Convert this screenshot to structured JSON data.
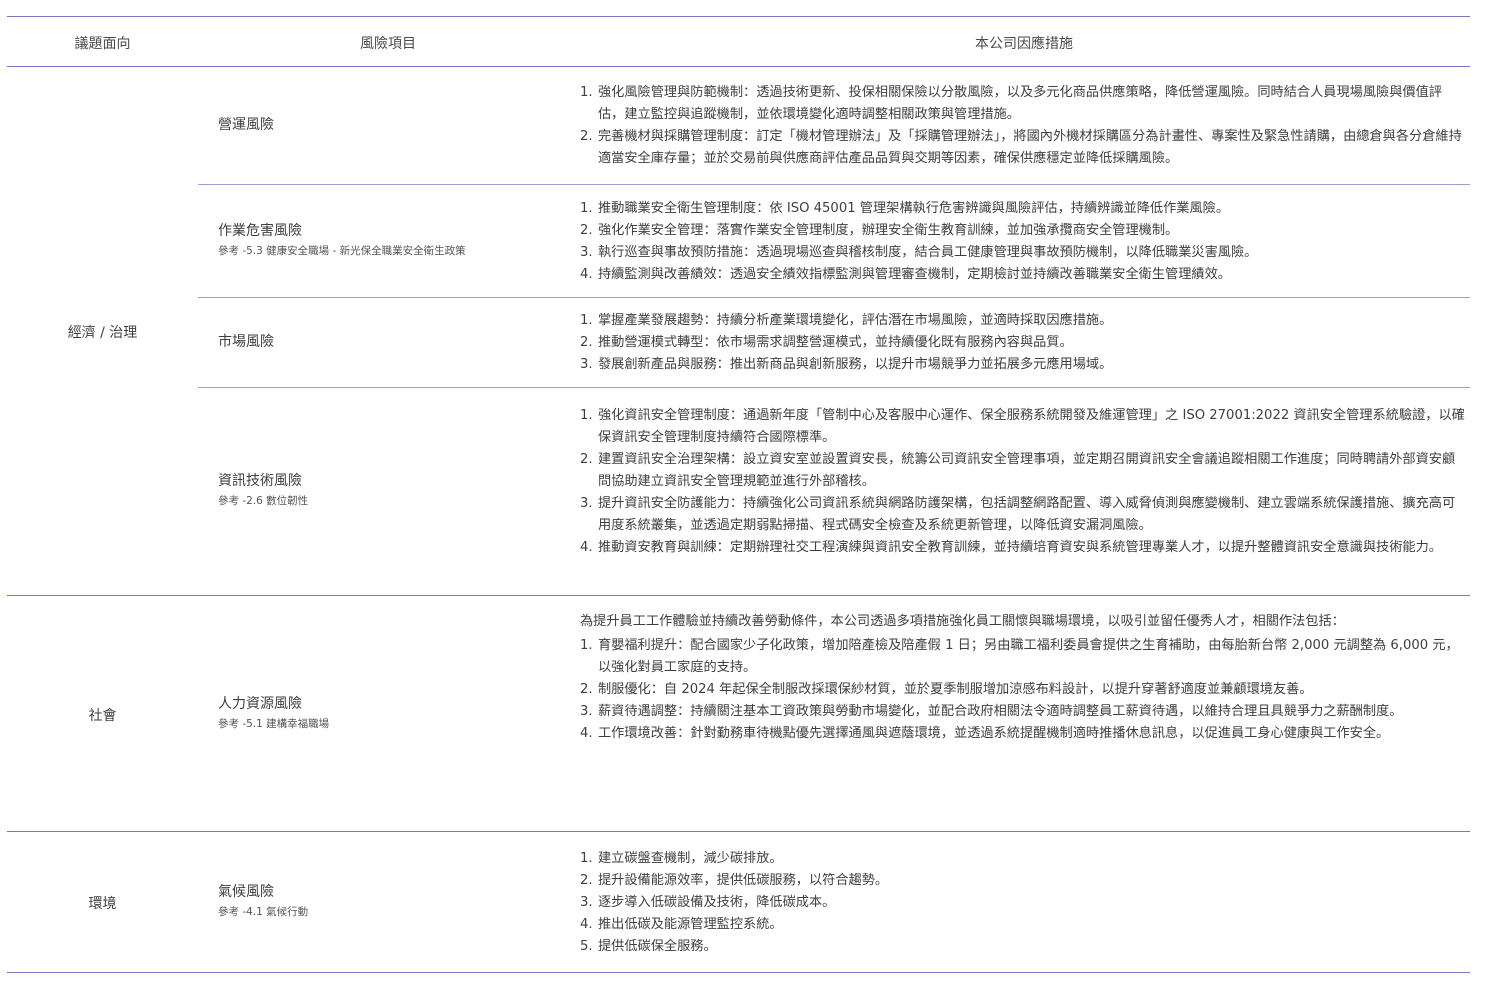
{
  "header": {
    "col1": "議題面向",
    "col2": "風險項目",
    "col3": "本公司因應措施"
  },
  "categories": {
    "economy": "經濟 / 治理",
    "society": "社會",
    "environment": "環境"
  },
  "risks": [
    {
      "name": "營運風險",
      "ref": "",
      "measures": [
        "強化風險管理與防範機制：透過技術更新、投保相關保險以分散風險，以及多元化商品供應策略，降低營運風險。同時結合人員現場風險與價值評估，建立監控與追蹤機制，並依環境變化適時調整相關政策與管理措施。",
        "完善機材與採購管理制度：訂定「機材管理辦法」及「採購管理辦法」，將國內外機材採購區分為計畫性、專案性及緊急性請購，由總倉與各分倉維持適當安全庫存量；並於交易前與供應商評估產品品質與交期等因素，確保供應穩定並降低採購風險。"
      ]
    },
    {
      "name": "作業危害風險",
      "ref": "參考 -5.3 健康安全職場 - 新光保全職業安全衛生政策",
      "measures": [
        "推動職業安全衛生管理制度：依 ISO 45001 管理架構執行危害辨識與風險評估，持續辨識並降低作業風險。",
        "強化作業安全管理：落實作業安全管理制度，辦理安全衛生教育訓練，並加強承攬商安全管理機制。",
        "執行巡查與事故預防措施：透過現場巡查與稽核制度，結合員工健康管理與事故預防機制，以降低職業災害風險。",
        "持續監測與改善績效：透過安全績效指標監測與管理審查機制，定期檢討並持續改善職業安全衛生管理績效。"
      ]
    },
    {
      "name": "市場風險",
      "ref": "",
      "measures": [
        "掌握產業發展趨勢：持續分析產業環境變化，評估潛在市場風險，並適時採取因應措施。",
        "推動營運模式轉型：依市場需求調整營運模式，並持續優化既有服務內容與品質。",
        "發展創新產品與服務：推出新商品與創新服務，以提升市場競爭力並拓展多元應用場域。"
      ]
    },
    {
      "name": "資訊技術風險",
      "ref": "參考 -2.6 數位韌性",
      "measures": [
        "強化資訊安全管理制度：通過新年度「管制中心及客服中心運作、保全服務系統開發及維運管理」之 ISO 27001:2022 資訊安全管理系統驗證，以確保資訊安全管理制度持續符合國際標準。",
        "建置資訊安全治理架構：設立資安室並設置資安長，統籌公司資訊安全管理事項，並定期召開資訊安全會議追蹤相關工作進度；同時聘請外部資安顧問協助建立資訊安全管理規範並進行外部稽核。",
        "提升資訊安全防護能力：持續強化公司資訊系統與網路防護架構，包括調整網路配置、導入威脅偵測與應變機制、建立雲端系統保護措施、擴充高可用度系統叢集，並透過定期弱點掃描、程式碼安全檢查及系統更新管理，以降低資安漏洞風險。",
        "推動資安教育與訓練：定期辦理社交工程演練與資訊安全教育訓練，並持續培育資安與系統管理專業人才，以提升整體資訊安全意識與技術能力。"
      ]
    },
    {
      "name": "人力資源風險",
      "ref": "參考 -5.1 建構幸福職場",
      "intro": "為提升員工工作體驗並持續改善勞動條件，本公司透過多項措施強化員工關懷與職場環境，以吸引並留任優秀人才，相關作法包括：",
      "measures": [
        "育嬰福利提升：配合國家少子化政策，增加陪產檢及陪產假 1 日；另由職工福利委員會提供之生育補助，由每胎新台幣 2,000 元調整為 6,000 元，以強化對員工家庭的支持。",
        "制服優化：自 2024 年起保全制服改採環保紗材質，並於夏季制服增加涼感布料設計，以提升穿著舒適度並兼顧環境友善。",
        "薪資待遇調整：持續關注基本工資政策與勞動市場變化，並配合政府相關法令適時調整員工薪資待遇，以維持合理且具競爭力之薪酬制度。",
        "工作環境改善：針對勤務車待機點優先選擇通風與遮蔭環境，並透過系統提醒機制適時推播休息訊息，以促進員工身心健康與工作安全。"
      ]
    },
    {
      "name": "氣候風險",
      "ref": "參考 -4.1 氣候行動",
      "measures": [
        "建立碳盤查機制，減少碳排放。",
        "提升設備能源效率，提供低碳服務，以符合趨勢。",
        "逐步導入低碳設備及技術，降低碳成本。",
        "推出低碳及能源管理監控系統。",
        "提供低碳保全服務。"
      ]
    }
  ]
}
